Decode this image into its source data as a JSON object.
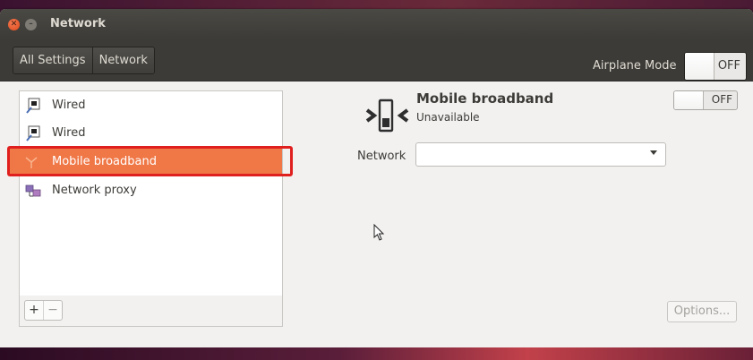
{
  "window": {
    "title": "Network"
  },
  "toolbar": {
    "breadcrumbs": [
      {
        "label": "All Settings"
      },
      {
        "label": "Network"
      }
    ],
    "airplane_label": "Airplane Mode",
    "airplane_state": "OFF"
  },
  "sidebar": {
    "items": [
      {
        "label": "Wired",
        "icon": "wired-icon"
      },
      {
        "label": "Wired",
        "icon": "wired-icon"
      },
      {
        "label": "Mobile broadband",
        "icon": "mobile-broadband-icon",
        "selected": true
      },
      {
        "label": "Network proxy",
        "icon": "network-proxy-icon"
      }
    ],
    "add_label": "+",
    "remove_label": "−"
  },
  "device": {
    "name": "Mobile broadband",
    "status": "Unavailable",
    "switch_state": "OFF",
    "network_label": "Network",
    "network_value": "",
    "options_label": "Options..."
  },
  "colors": {
    "accent": "#f07746",
    "highlight": "#e0201f",
    "titlebar": "#3c3b37"
  }
}
